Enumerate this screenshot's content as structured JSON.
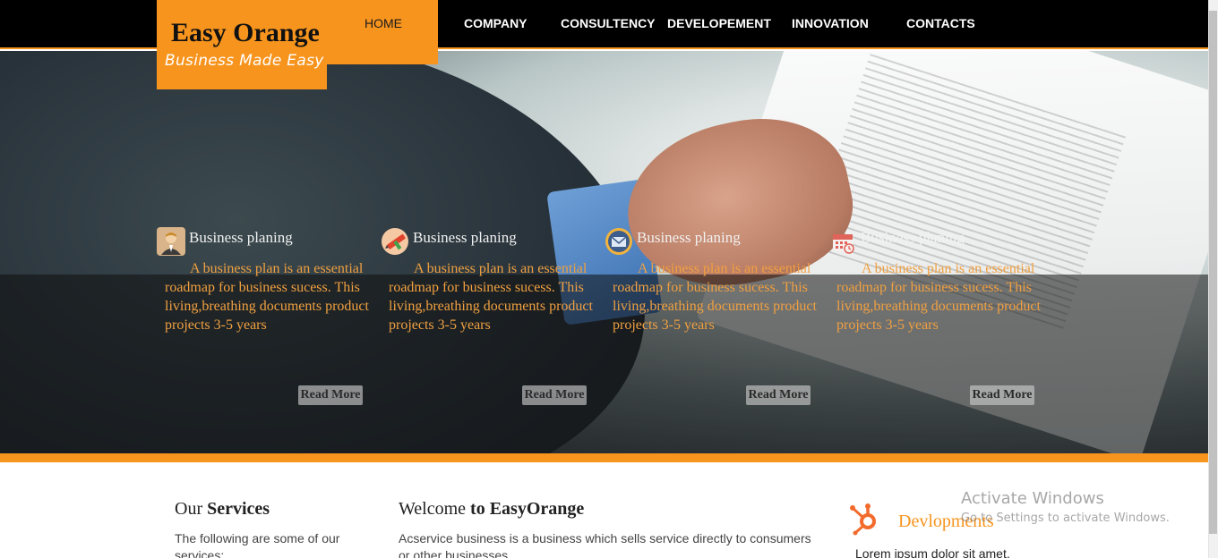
{
  "brand": {
    "title": "Easy Orange",
    "tagline": "Business Made Easy"
  },
  "nav": {
    "items": [
      {
        "label": "HOME",
        "active": true
      },
      {
        "label": "COMPANY"
      },
      {
        "label": "CONSULTENCY"
      },
      {
        "label": "DEVELOPEMENT"
      },
      {
        "label": "INNOVATION"
      },
      {
        "label": "CONTACTS"
      }
    ]
  },
  "cards": [
    {
      "icon": "person-icon",
      "title": "Business planing",
      "text": "A business plan is an essential roadmap for business sucess. This living,breathing documents product projects 3-5 years",
      "button": "Read More"
    },
    {
      "icon": "pencil-icon",
      "title": "Business planing",
      "text": "A business plan is an essential roadmap for business sucess. This living,breathing documents product projects 3-5 years",
      "button": "Read More"
    },
    {
      "icon": "envelope-icon",
      "title": "Business planing",
      "text": "A business plan is an essential roadmap for business sucess. This living,breathing documents product projects 3-5 years",
      "button": "Read More"
    },
    {
      "icon": "calendar-icon",
      "title": "Business planing",
      "text": "A business plan is an essential roadmap for business sucess. This living,breathing documents product projects 3-5 years",
      "button": "Read More"
    }
  ],
  "services": {
    "title_a": "Our ",
    "title_b": "Services",
    "text": "The following are some of our services:"
  },
  "welcome": {
    "title_a": "Welcome ",
    "title_b": "to EasyOrange",
    "text": "Acservice business is a business which sells service directly to consumers or other businesses"
  },
  "developments": {
    "title": "Devlopments",
    "text": "Lorem ipsum dolor sit amet,"
  },
  "watermark": {
    "line1": "Activate Windows",
    "line2": "Go to Settings to activate Windows."
  },
  "colors": {
    "accent": "#f7941d",
    "nav_bg": "#000000"
  }
}
